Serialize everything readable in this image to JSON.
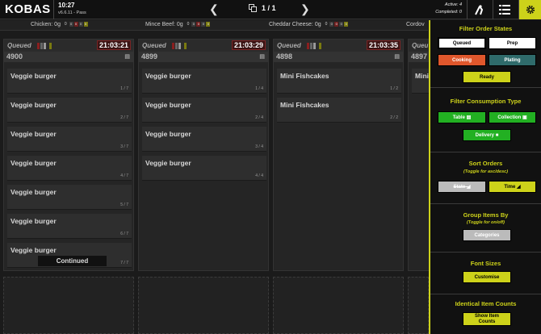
{
  "topbar": {
    "logo": "KOBAS",
    "time": "10:27",
    "version": "v6.6.11 - Pass",
    "page": "1 / 1",
    "active": "Active: 4",
    "completed": "Completed: 0"
  },
  "ingredients": [
    {
      "label": "Chicken: 0g",
      "num": "0",
      "boxes": [
        "0",
        "0",
        "0",
        "0"
      ]
    },
    {
      "label": "Mince Beef: 0g",
      "num": "0",
      "boxes": [
        "0",
        "0",
        "0",
        "0"
      ]
    },
    {
      "label": "Cheddar Cheese: 0g",
      "num": "0",
      "boxes": [
        "0",
        "0",
        "0",
        "0"
      ]
    },
    {
      "label": "Cordov"
    }
  ],
  "orders": [
    {
      "state": "Queued",
      "time": "21:03:21",
      "number": "4900",
      "items": [
        {
          "name": "Veggie burger",
          "count": "1 / 7"
        },
        {
          "name": "Veggie burger",
          "count": "2 / 7"
        },
        {
          "name": "Veggie burger",
          "count": "3 / 7"
        },
        {
          "name": "Veggie burger",
          "count": "4 / 7"
        },
        {
          "name": "Veggie burger",
          "count": "5 / 7"
        },
        {
          "name": "Veggie burger",
          "count": "6 / 7"
        },
        {
          "name": "Veggie burger",
          "count": "7 / 7"
        }
      ],
      "continued": "Continued"
    },
    {
      "state": "Queued",
      "time": "21:03:29",
      "number": "4899",
      "items": [
        {
          "name": "Veggie burger",
          "count": "1 / 4"
        },
        {
          "name": "Veggie burger",
          "count": "2 / 4"
        },
        {
          "name": "Veggie burger",
          "count": "3 / 4"
        },
        {
          "name": "Veggie burger",
          "count": "4 / 4"
        }
      ]
    },
    {
      "state": "Queued",
      "time": "21:03:35",
      "number": "4898",
      "items": [
        {
          "name": "Mini Fishcakes",
          "count": "1 / 2"
        },
        {
          "name": "Mini Fishcakes",
          "count": "2 / 2"
        }
      ]
    },
    {
      "state": "Queu",
      "number": "4897",
      "items": [
        {
          "name": "Mini"
        }
      ]
    }
  ],
  "panel": {
    "filter_states": {
      "title": "Filter Order States",
      "queued": "Queued",
      "prep": "Prep",
      "cooking": "Cooking",
      "plating": "Plating",
      "ready": "Ready"
    },
    "consumption": {
      "title": "Filter Consumption Type",
      "table": "Table",
      "collection": "Collection",
      "delivery": "Delivery"
    },
    "sort": {
      "title": "Sort Orders",
      "subtitle": "(Toggle for asc/desc)",
      "state": "State",
      "time": "Time"
    },
    "group": {
      "title": "Group Items By",
      "subtitle": "(Toggle for on/off)",
      "categories": "Categories"
    },
    "font": {
      "title": "Font Sizes",
      "customise": "Customise"
    },
    "identical": {
      "title": "Identical Item Counts",
      "show_line1": "Show Item",
      "show_line2": "Counts"
    }
  },
  "colors": {
    "accent": "#cdd21a",
    "cooking": "#e0572c",
    "plating": "#2f6b6b",
    "green": "#22b022",
    "ready": "#cdd21a"
  }
}
